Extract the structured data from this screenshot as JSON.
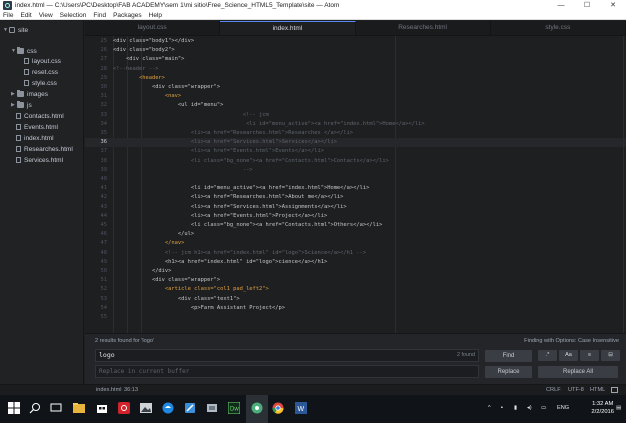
{
  "window": {
    "title": "index.html — C:\\Users\\PC\\Desktop\\FAB ACADEMY\\sem 1\\mi sitio\\Free_Science_HTML5_Template\\site — Atom"
  },
  "menu": [
    "File",
    "Edit",
    "View",
    "Selection",
    "Find",
    "Packages",
    "Help"
  ],
  "tree": {
    "root": "site",
    "items": [
      {
        "label": "css",
        "type": "folder",
        "open": true,
        "depth": 1
      },
      {
        "label": "layout.css",
        "type": "file",
        "depth": 2
      },
      {
        "label": "reset.css",
        "type": "file",
        "depth": 2
      },
      {
        "label": "style.css",
        "type": "file",
        "depth": 2
      },
      {
        "label": "images",
        "type": "folder",
        "open": false,
        "depth": 1
      },
      {
        "label": "js",
        "type": "folder",
        "open": false,
        "depth": 1
      },
      {
        "label": "Contacts.html",
        "type": "file",
        "depth": 1
      },
      {
        "label": "Events.html",
        "type": "file",
        "depth": 1
      },
      {
        "label": "index.html",
        "type": "file",
        "depth": 1
      },
      {
        "label": "Researches.html",
        "type": "file",
        "depth": 1
      },
      {
        "label": "Services.html",
        "type": "file",
        "depth": 1
      }
    ]
  },
  "tabs": [
    {
      "label": "layout.css",
      "active": false
    },
    {
      "label": "index.html",
      "active": true
    },
    {
      "label": "Researches.html",
      "active": false
    },
    {
      "label": "style.css",
      "active": false
    }
  ],
  "editor": {
    "current_line": 36,
    "lines": [
      {
        "n": "25",
        "text": "<div class=\"body1\"></div>",
        "kind": "normal"
      },
      {
        "n": "26",
        "text": "<div class=\"body2\">",
        "kind": "normal"
      },
      {
        "n": "27",
        "text": "    <div class=\"main\">",
        "kind": "normal"
      },
      {
        "n": "28",
        "text": "<!--header -->",
        "kind": "comment"
      },
      {
        "n": "29",
        "text": "        <header>",
        "kind": "normal"
      },
      {
        "n": "30",
        "text": "            <div class=\"wrapper\">",
        "kind": "normal"
      },
      {
        "n": "31",
        "text": "                <nav>",
        "kind": "normal"
      },
      {
        "n": "32",
        "text": "                    <ul id=\"menu\">",
        "kind": "normal"
      },
      {
        "n": "33",
        "text": "                                        <!-- jcm",
        "kind": "comment"
      },
      {
        "n": "34",
        "text": "                                         <li id=\"menu_active\"><a href=\"index.html\">Home</a></li>",
        "kind": "comment"
      },
      {
        "n": "35",
        "text": "                        <li><a href=\"Researches.html\">Researches </a></li>",
        "kind": "comment"
      },
      {
        "n": "36",
        "text": "                        <li><a href=\"Services.html\">Services</a></li>",
        "kind": "comment"
      },
      {
        "n": "37",
        "text": "                        <li><a href=\"Events.html\">Events</a></li>",
        "kind": "comment"
      },
      {
        "n": "38",
        "text": "                        <li class=\"bg_none\"><a href=\"Contacts.html\">Contacts</a></li>",
        "kind": "comment"
      },
      {
        "n": "39",
        "text": "                                        -->",
        "kind": "comment"
      },
      {
        "n": "40",
        "text": "",
        "kind": "normal"
      },
      {
        "n": "41",
        "text": "                        <li id=\"menu_active\"><a href=\"index.html\">Home</a></li>",
        "kind": "normal"
      },
      {
        "n": "42",
        "text": "                        <li><a href=\"Researches.html\">About me</a></li>",
        "kind": "normal"
      },
      {
        "n": "43",
        "text": "                        <li><a href=\"Services.html\">Assignments</a></li>",
        "kind": "normal"
      },
      {
        "n": "44",
        "text": "                        <li><a href=\"Events.html\">Project</a></li>",
        "kind": "normal"
      },
      {
        "n": "45",
        "text": "                        <li class=\"bg_none\"><a href=\"Contacts.html\">Others</a></li>",
        "kind": "normal"
      },
      {
        "n": "46",
        "text": "                    </ul>",
        "kind": "normal"
      },
      {
        "n": "47",
        "text": "                </nav>",
        "kind": "normal"
      },
      {
        "n": "48",
        "text": "                <!-- jcm h1><a href=\"index.html\" id=\"logo\">Science</a></h1 -->",
        "kind": "comment"
      },
      {
        "n": "49",
        "text": "                <h1><a href=\"index.html\" id=\"logo\">cience</a></h1>",
        "kind": "normal"
      },
      {
        "n": "50",
        "text": "            </div>",
        "kind": "normal"
      },
      {
        "n": "51",
        "text": "            <div class=\"wrapper\">",
        "kind": "normal"
      },
      {
        "n": "52",
        "text": "                <article class=\"col1 pad_left2\">",
        "kind": "normal"
      },
      {
        "n": "53",
        "text": "                    <div class=\"text1\">",
        "kind": "normal"
      },
      {
        "n": "54",
        "text": "                        <p>Farm Assistant Project</p>",
        "kind": "normal"
      },
      {
        "n": "55",
        "text": "",
        "kind": "normal"
      }
    ]
  },
  "find": {
    "status": "2 results found for 'logo'",
    "options_text": "Finding with Options: Case Insensitive",
    "query": "logo",
    "count": "2 found",
    "replace_placeholder": "Replace in current buffer",
    "find_label": "Find",
    "replace_label": "Replace",
    "replace_all_label": "Replace All",
    "opt_regex": ".*",
    "opt_case": "Aa",
    "opt_selection": "≡",
    "opt_word": "⊟"
  },
  "status": {
    "file": "index.html",
    "cursor": "36:13",
    "line_ending": "CRLF",
    "encoding": "UTF-8",
    "grammar": "HTML"
  },
  "taskbar": {
    "language": "ENG",
    "time": "1:32 AM",
    "date": "2/2/2016",
    "accent": "#0078d7"
  }
}
